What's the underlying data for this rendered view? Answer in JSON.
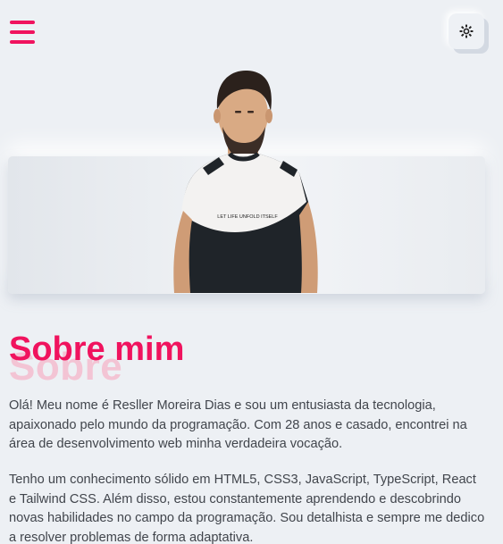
{
  "header": {
    "menu_icon": "hamburger-menu-icon",
    "theme_icon": "sun-icon"
  },
  "hero": {
    "shirt_text": "LET LIFE UNFOLD ITSELF"
  },
  "about": {
    "title": "Sobre mim",
    "title_shadow": "Sobre",
    "paragraphs": [
      "Olá! Meu nome é Resller Moreira Dias e sou um entusiasta da tecnologia, apaixonado pelo mundo da programação. Com 28 anos e casado, encontrei na área de desenvolvimento web minha verdadeira vocação.",
      "Tenho um conhecimento sólido em HTML5, CSS3, JavaScript, TypeScript, React e Tailwind CSS. Além disso, estou constantemente aprendendo e descobrindo novas habilidades no campo da programação. Sou detalhista e sempre me dedico a resolver problemas de forma adaptativa."
    ]
  },
  "colors": {
    "accent": "#f0135e",
    "background": "#edf0f4",
    "text": "#41454c"
  }
}
